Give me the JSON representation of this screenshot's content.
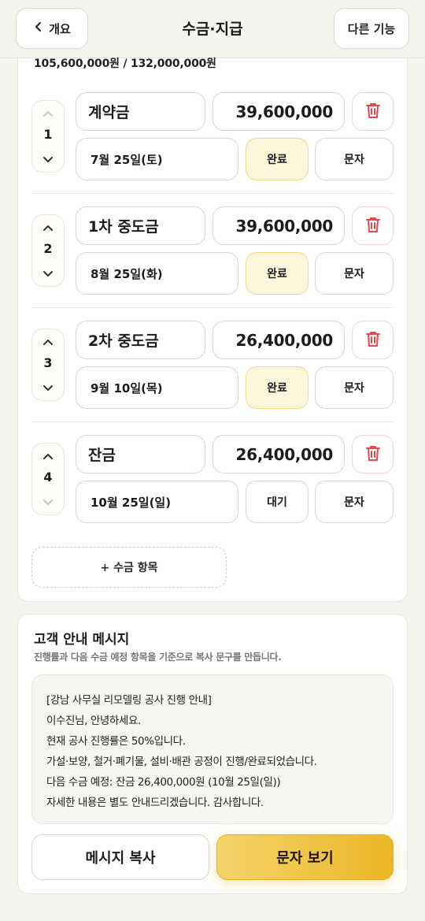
{
  "header": {
    "back_label": "개요",
    "title": "수금·지급",
    "more_label": "다른 기능"
  },
  "progress": {
    "text": "105,600,000원 / 132,000,000원",
    "collected": 105600000,
    "total": 132000000
  },
  "items": [
    {
      "index": "1",
      "name": "계약금",
      "amount": "39,600,000",
      "date": "7월 25일(토)",
      "status": "완료",
      "status_done": true,
      "sms_label": "문자"
    },
    {
      "index": "2",
      "name": "1차 중도금",
      "amount": "39,600,000",
      "date": "8월 25일(화)",
      "status": "완료",
      "status_done": true,
      "sms_label": "문자"
    },
    {
      "index": "3",
      "name": "2차 중도금",
      "amount": "26,400,000",
      "date": "9월 10일(목)",
      "status": "완료",
      "status_done": true,
      "sms_label": "문자"
    },
    {
      "index": "4",
      "name": "잔금",
      "amount": "26,400,000",
      "date": "10월 25일(일)",
      "status": "대기",
      "status_done": false,
      "sms_label": "문자"
    }
  ],
  "add_label": "+ 수금 항목",
  "message": {
    "title": "고객 안내 메시지",
    "subtitle": "진행률과 다음 수금 예정 항목을 기준으로 복사 문구를 만듭니다.",
    "lines": [
      "[강남 사무실 리모델링 공사 진행 안내]",
      "이수진님, 안녕하세요.",
      "현재 공사 진행률은 50%입니다.",
      "가설·보양, 철거·폐기물, 설비·배관 공정이 진행/완료되었습니다.",
      "다음 수금 예정: 잔금 26,400,000원 (10월 25일(일))",
      "자세한 내용은 별도 안내드리겠습니다. 감사합니다."
    ],
    "copy_label": "메시지 복사",
    "sms_label": "문자 보기"
  },
  "colors": {
    "accent": "#ecb626",
    "done_bg": "#fdf5dc",
    "delete_red": "#e5484d"
  }
}
